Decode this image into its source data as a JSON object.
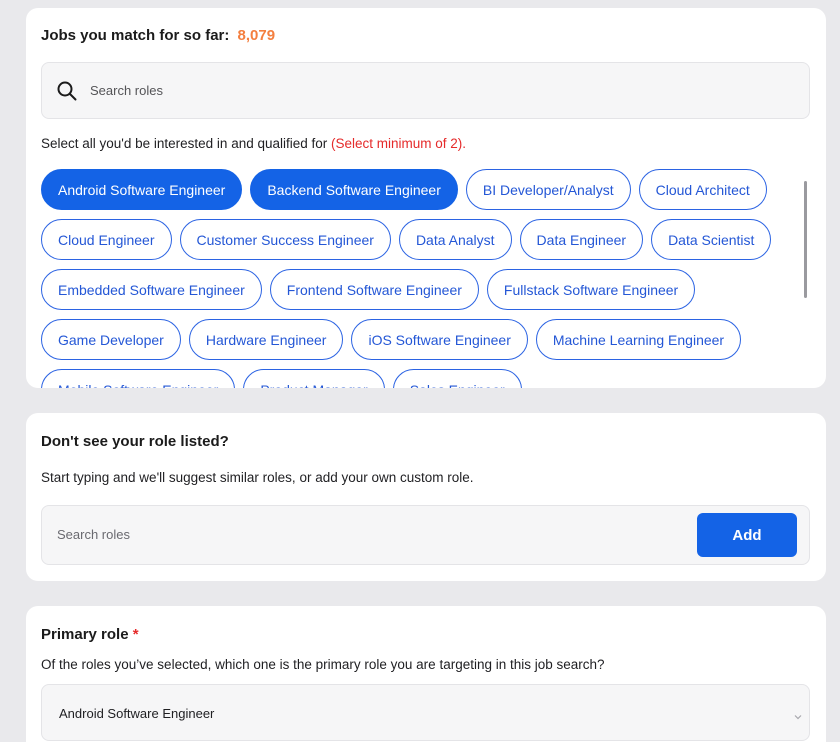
{
  "match": {
    "label": "Jobs you match for so far:",
    "count": "8,079"
  },
  "search": {
    "placeholder": "Search roles"
  },
  "instruction": {
    "text": "Select all you'd be interested in and qualified for ",
    "minimum": "(Select minimum of 2)."
  },
  "roles": [
    {
      "label": "Android Software Engineer",
      "selected": true
    },
    {
      "label": "Backend Software Engineer",
      "selected": true
    },
    {
      "label": "BI Developer/Analyst",
      "selected": false
    },
    {
      "label": "Cloud Architect",
      "selected": false
    },
    {
      "label": "Cloud Engineer",
      "selected": false
    },
    {
      "label": "Customer Success Engineer",
      "selected": false
    },
    {
      "label": "Data Analyst",
      "selected": false
    },
    {
      "label": "Data Engineer",
      "selected": false
    },
    {
      "label": "Data Scientist",
      "selected": false
    },
    {
      "label": "Embedded Software Engineer",
      "selected": false
    },
    {
      "label": "Frontend Software Engineer",
      "selected": false
    },
    {
      "label": "Fullstack Software Engineer",
      "selected": false
    },
    {
      "label": "Game Developer",
      "selected": false
    },
    {
      "label": "Hardware Engineer",
      "selected": false
    },
    {
      "label": "iOS Software Engineer",
      "selected": false
    },
    {
      "label": "Machine Learning Engineer",
      "selected": false
    },
    {
      "label": "Mobile Software Engineer",
      "selected": false
    },
    {
      "label": "Product Manager",
      "selected": false
    },
    {
      "label": "Sales Engineer",
      "selected": false
    }
  ],
  "custom": {
    "title": "Don't see your role listed?",
    "description": "Start typing and we'll suggest similar roles, or add your own custom role.",
    "placeholder": "Search roles",
    "add_label": "Add"
  },
  "primary": {
    "title": "Primary role",
    "required_mark": "*",
    "description": "Of the roles you’ve selected, which one is the primary role you are targeting in this job search?",
    "selected": "Android Software Engineer"
  },
  "colors": {
    "accent": "#1463e6",
    "count": "#f47f3f",
    "required": "#e52a2a"
  }
}
